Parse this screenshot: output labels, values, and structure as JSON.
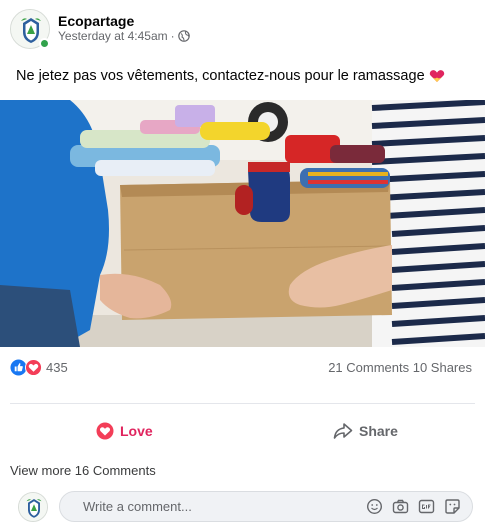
{
  "post": {
    "page_name": "Ecopartage",
    "timestamp": "Yesterday at 4:45am",
    "visibility_icon": "globe-icon",
    "text": "Ne jetez pas vos vêtements, contactez-nous pour le ramassage",
    "emoji": "heart-emoji"
  },
  "reactions": {
    "icons": [
      "like-reaction",
      "love-reaction"
    ],
    "count": "435",
    "comments": "21 Comments",
    "shares": "10 Shares"
  },
  "actions": {
    "love_label": "Love",
    "share_label": "Share"
  },
  "comments": {
    "view_more": "View more 16 Comments",
    "placeholder": "Write a comment...",
    "icons": [
      "emoji-icon",
      "camera-icon",
      "gif-icon",
      "sticker-icon"
    ]
  },
  "colors": {
    "love": "#e0245e",
    "like": "#1877f2",
    "online": "#31a24c",
    "muted_text": "#65676b"
  }
}
